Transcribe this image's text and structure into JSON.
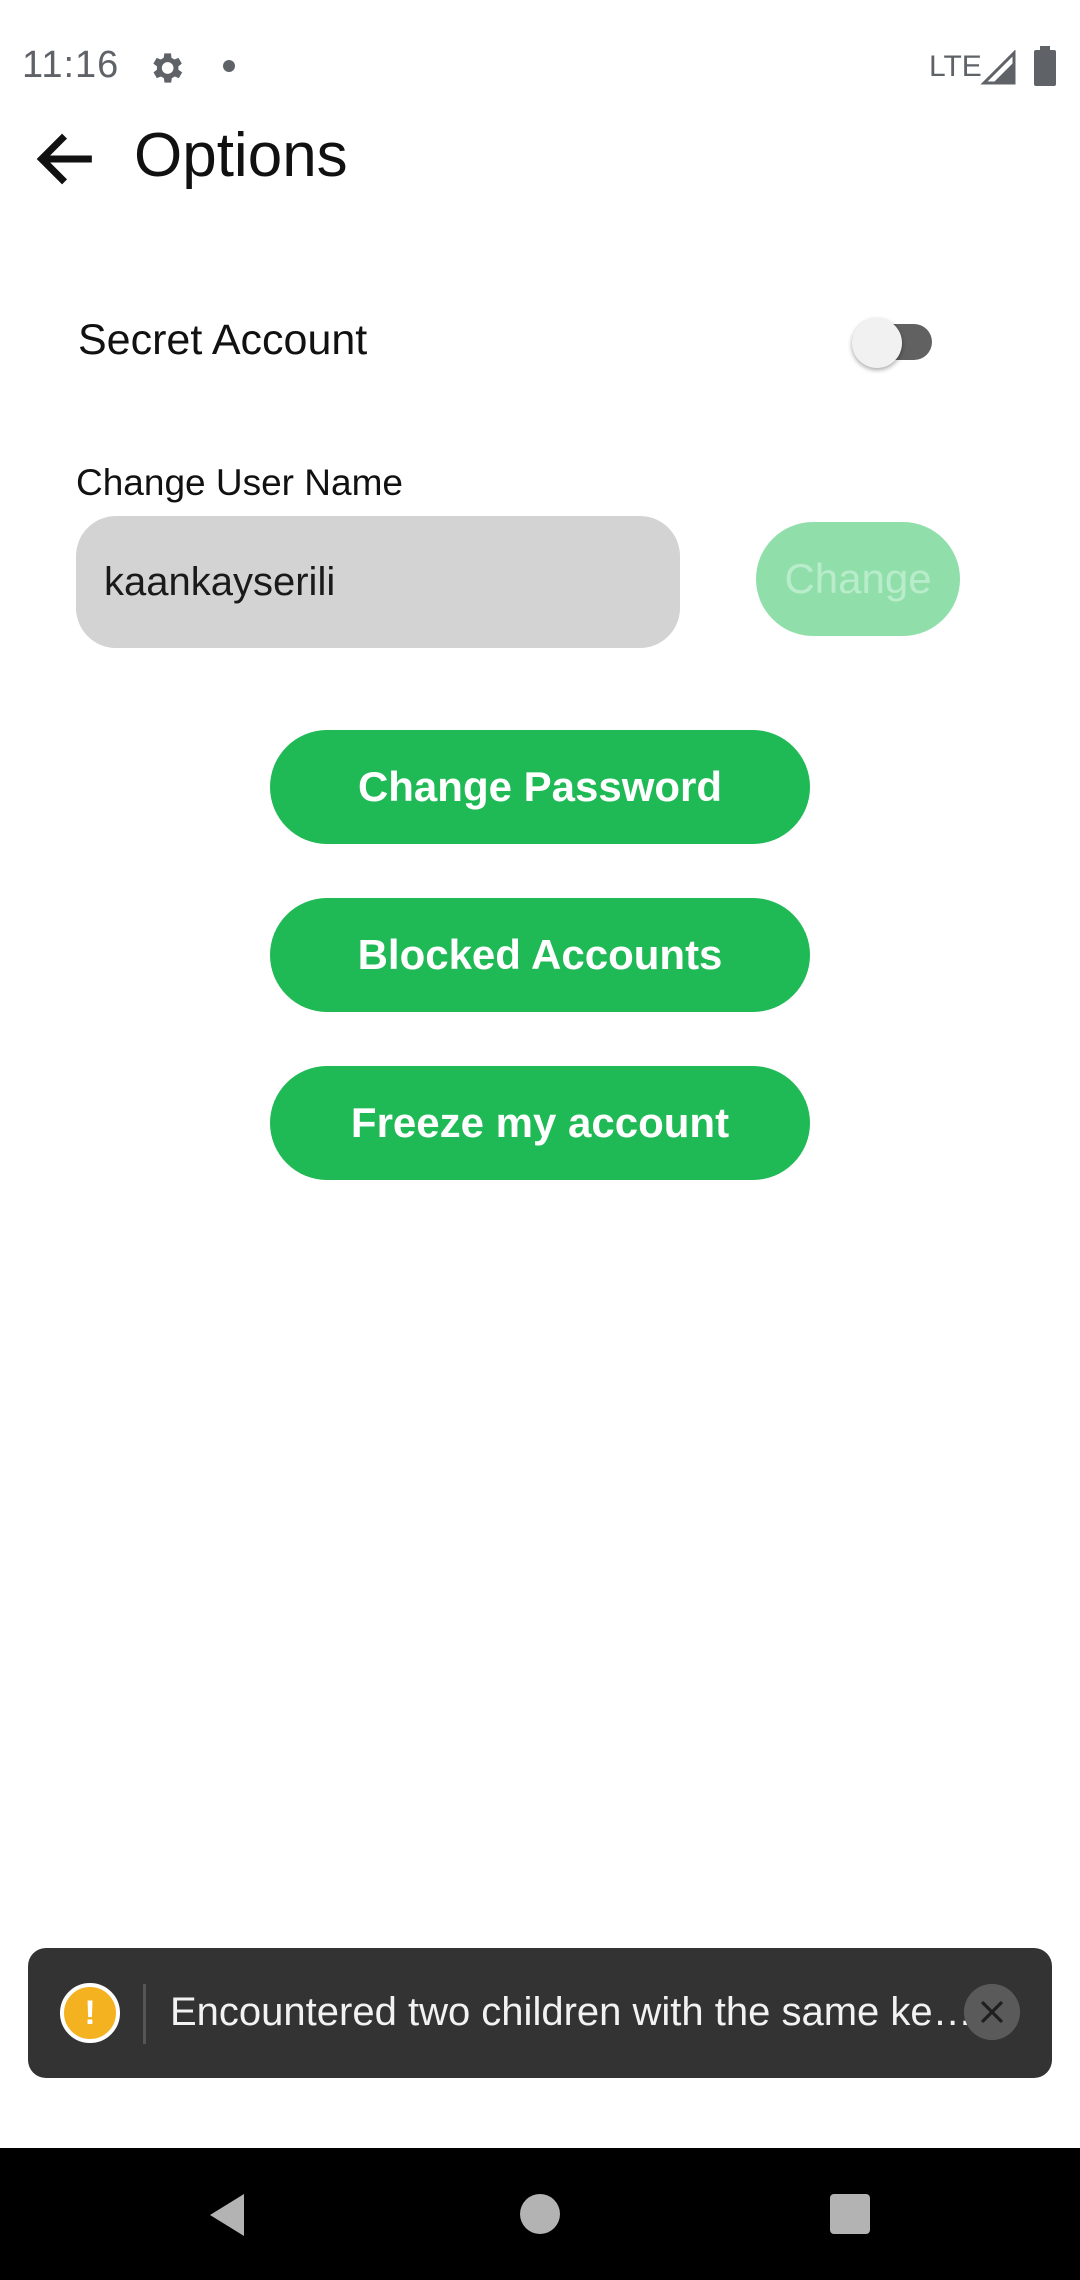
{
  "status_bar": {
    "time": "11:16",
    "network": "LTE",
    "icons": [
      "gear-icon",
      "dot-icon",
      "signal-icon",
      "battery-icon"
    ]
  },
  "app_bar": {
    "title": "Options",
    "back_icon": "arrow-left-icon"
  },
  "secret_account": {
    "label": "Secret Account",
    "enabled": false
  },
  "username": {
    "label": "Change User Name",
    "value": "kaankayserili",
    "button_label": "Change"
  },
  "actions": {
    "change_password": "Change Password",
    "blocked_accounts": "Blocked Accounts",
    "freeze_account": "Freeze my account"
  },
  "toast": {
    "icon": "warning-icon",
    "message": "Encountered two children with the same ke…",
    "close_icon": "close-icon"
  },
  "colors": {
    "primary_green": "#1fba55",
    "disabled_green": "#90dfab",
    "input_bg": "#d3d3d3",
    "toast_bg": "#333333",
    "warning": "#f4b221"
  },
  "nav_bar": {
    "icons": [
      "back-triangle-icon",
      "home-circle-icon",
      "recents-square-icon"
    ]
  }
}
